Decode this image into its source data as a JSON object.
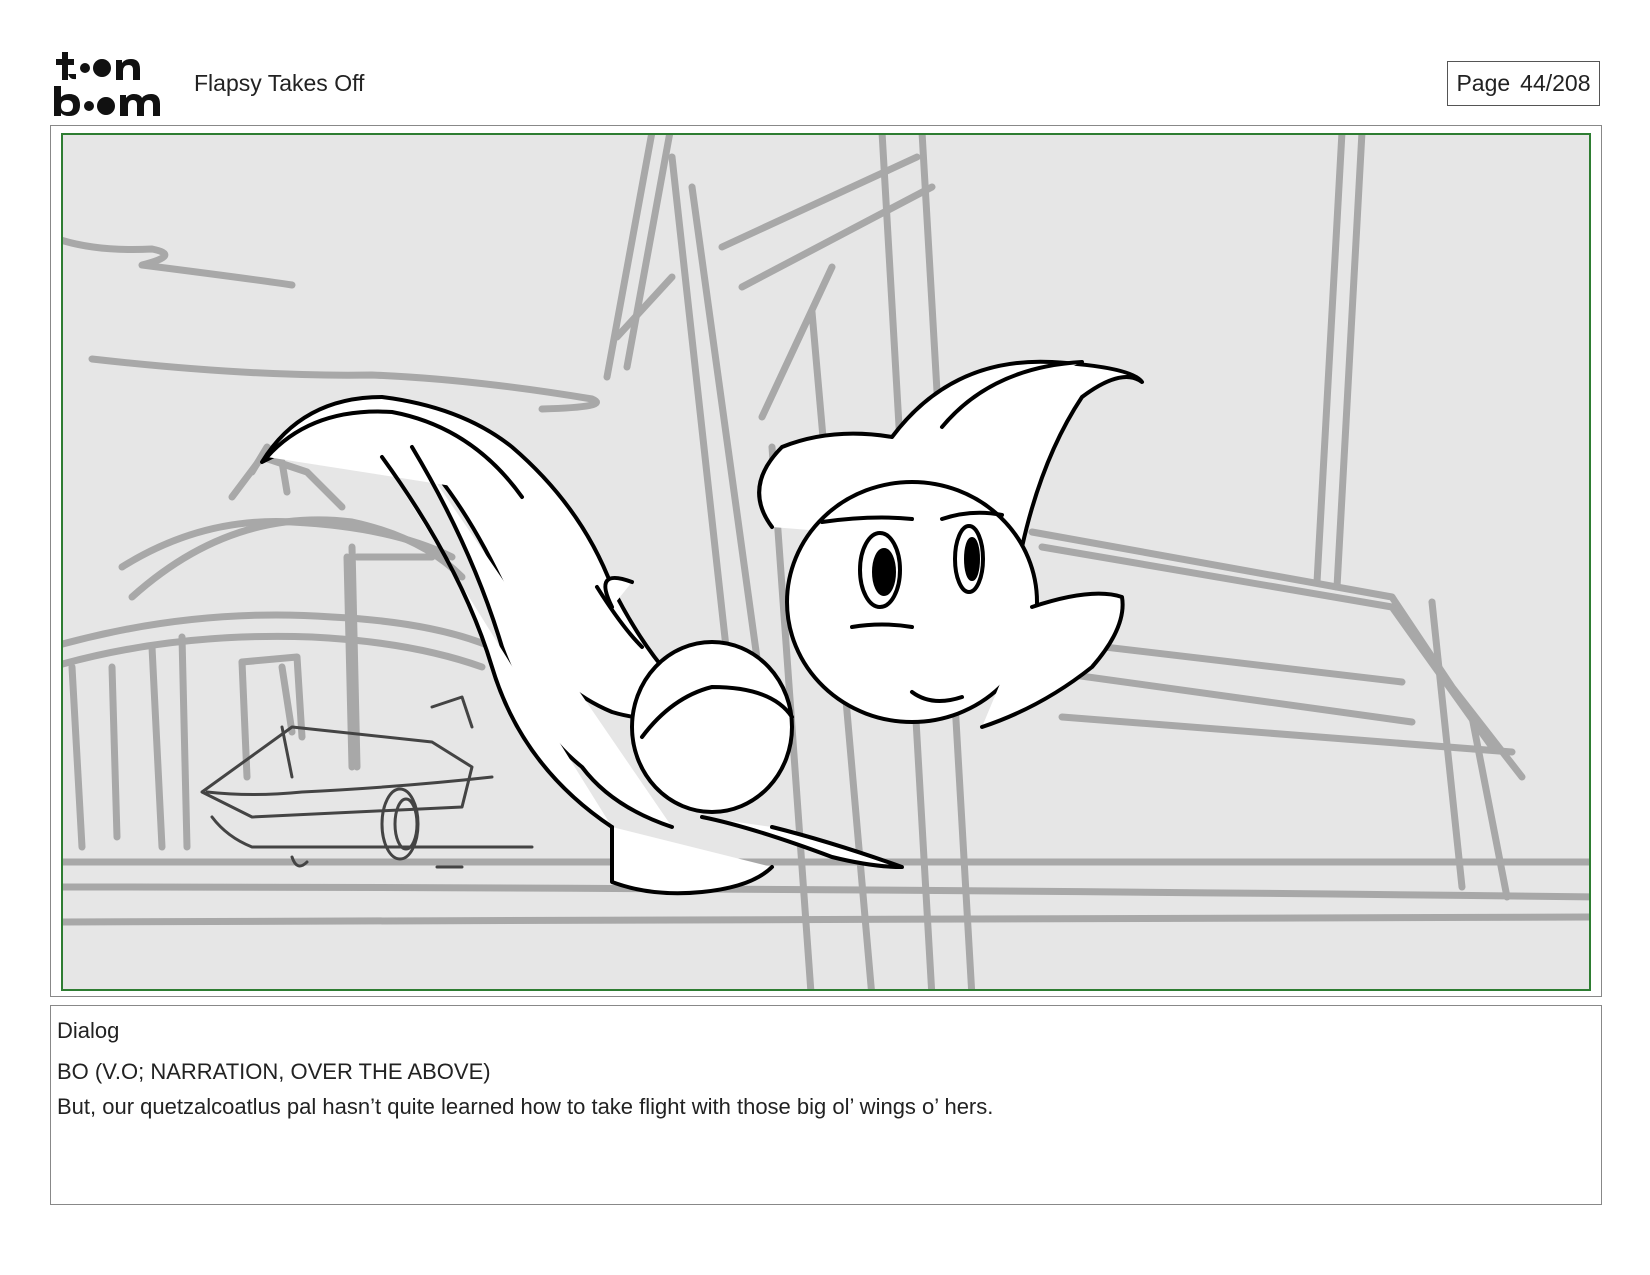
{
  "header": {
    "logo_text_top": "toon",
    "logo_text_bottom": "boom",
    "project_title": "Flapsy Takes Off",
    "page_label": "Page",
    "page_number": "44/208"
  },
  "panel": {
    "frame_color": "#2e7d32",
    "background_color": "#e6e6e6",
    "sketch_line_color": "#a8a8a8",
    "character_line_color": "#000000"
  },
  "dialog": {
    "heading": "Dialog",
    "speaker": "BO (V.O; NARRATION, OVER THE ABOVE)",
    "line": "But, our quetzalcoatlus pal hasn’t quite learned how to take flight with those big ol’ wings o’ hers."
  }
}
